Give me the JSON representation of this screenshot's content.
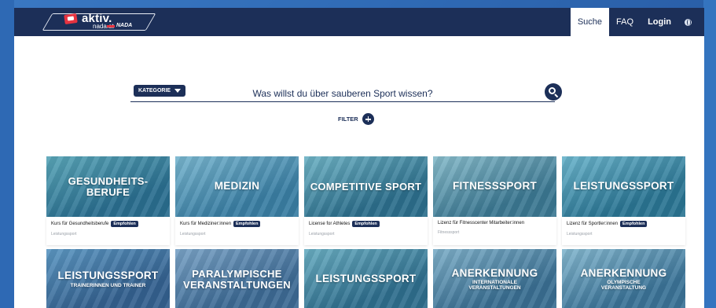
{
  "header": {
    "logo_text": "aktiv.",
    "logo_sub": "nada.at",
    "logo_nada": "NADA",
    "nav": [
      {
        "label": "Suche",
        "active": true
      },
      {
        "label": "FAQ",
        "active": false
      },
      {
        "label": "Login",
        "active": false
      }
    ],
    "language_icon": "globe-icon"
  },
  "search": {
    "category_label": "KATEGORIE",
    "placeholder": "Was willst du über sauberen Sport wissen?",
    "value": ""
  },
  "filter": {
    "label": "FILTER"
  },
  "colors": {
    "navy": "#1c2f58",
    "accent_red": "#e63340"
  },
  "cards": [
    {
      "title": "GESUNDHEITS-\nBERUFE",
      "subtitle": "",
      "course": "Kurs für Gesundheitsberufe",
      "badge": "Empfohlen",
      "category": "Leistungssport",
      "color_a": "#2a6e8f",
      "color_b": "#5aa6b8"
    },
    {
      "title": "MEDIZIN",
      "subtitle": "",
      "course": "Kurs für Mediziner:innen",
      "badge": "Empfohlen",
      "category": "Leistungssport",
      "color_a": "#3a7ea3",
      "color_b": "#79b6cf"
    },
    {
      "title": "COMPETITIVE SPORT",
      "subtitle": "",
      "course": "License for Athletes",
      "badge": "Empfohlen",
      "category": "Leistungssport",
      "color_a": "#2d6f8c",
      "color_b": "#6fb3c5"
    },
    {
      "title": "FITNESSSPORT",
      "subtitle": "",
      "course": "Lizenz für Fitnesscenter Mitarbeiter:innen",
      "badge": "",
      "category": "Fitnesssport",
      "color_a": "#3c7892",
      "color_b": "#88bccb"
    },
    {
      "title": "LEISTUNGSSPORT",
      "subtitle": "",
      "course": "Lizenz für Sportler:innen",
      "badge": "Empfohlen",
      "category": "Leistungssport",
      "color_a": "#2b7593",
      "color_b": "#6cb5cc"
    },
    {
      "title": "LEISTUNGSSPORT",
      "subtitle": "TRAINERINNEN UND TRAINER",
      "course": "",
      "badge": "",
      "category": "",
      "color_a": "#34618f",
      "color_b": "#5c97c2"
    },
    {
      "title": "PARALYMPISCHE\nVERANSTALTUNGEN",
      "subtitle": "",
      "course": "",
      "badge": "",
      "category": "",
      "color_a": "#3d6a94",
      "color_b": "#7aa3c6"
    },
    {
      "title": "LEISTUNGSSPORT",
      "subtitle": "",
      "course": "",
      "badge": "",
      "category": "",
      "color_a": "#2f6e8d",
      "color_b": "#6aaec2"
    },
    {
      "title": "ANERKENNUNG",
      "subtitle": "INTERNATIONALE\nVERANSTALTUNGEN",
      "course": "",
      "badge": "",
      "category": "",
      "color_a": "#3a6f92",
      "color_b": "#7fb0c9"
    },
    {
      "title": "ANERKENNUNG",
      "subtitle": "OLYMPISCHE\nVERANSTALTUNG",
      "course": "",
      "badge": "",
      "category": "",
      "color_a": "#3b7397",
      "color_b": "#85b8cf"
    }
  ]
}
